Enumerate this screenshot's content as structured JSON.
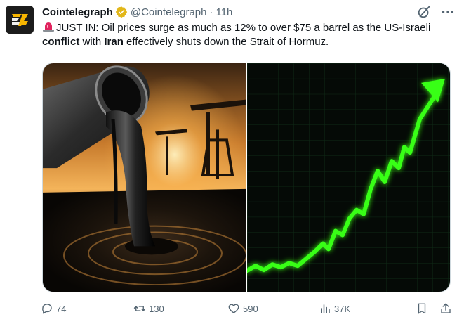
{
  "tweet": {
    "author_name": "Cointelegraph",
    "handle": "@Cointelegraph",
    "separator": "·",
    "time": "11h",
    "text_parts": [
      "JUST IN: Oil prices surge as much as 12% to over $75 a barrel as the US-Israeli ",
      "conflict",
      " with ",
      "Iran",
      " effectively shuts down the Strait of Hormuz."
    ]
  },
  "icons": {
    "verified": "verified-badge-icon",
    "grok": "grok-icon",
    "more": "more-icon",
    "alert": "rotating-light-icon",
    "reply": "reply-icon",
    "retweet": "retweet-icon",
    "like": "heart-icon",
    "views": "views-icon",
    "bookmark": "bookmark-icon",
    "share": "share-icon"
  },
  "metrics": {
    "replies": "74",
    "retweets": "130",
    "likes": "590",
    "views": "37K"
  },
  "colors": {
    "verified": "#e2b719",
    "text": "#0f1419",
    "muted": "#536471",
    "chart_line": "#39ff14"
  }
}
